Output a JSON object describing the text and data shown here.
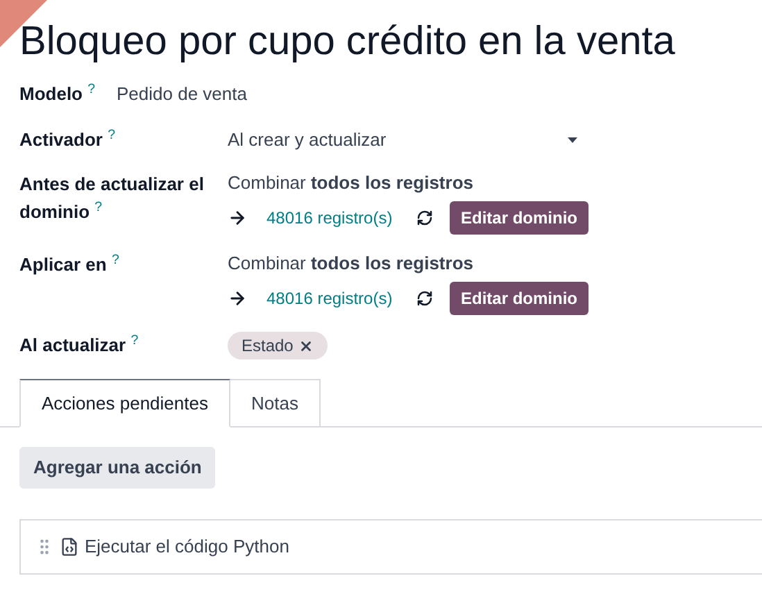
{
  "title": "Bloqueo por cupo crédito en la venta",
  "model": {
    "label": "Modelo $^{?}$",
    "value": "Pedido de venta"
  },
  "trigger": {
    "label": "Activador $^{?}$",
    "value": "Al crear y actualizar"
  },
  "domains": [
    {
      "label": "Antes de actualizar el dominio $^{?}$",
      "summary": "Combinar **todos los registros**",
      "count": "48016 registro(s)",
      "button": "Editar dominio"
    },
    {
      "label": "Aplicar en $^{?}$",
      "summary": "Combinar **todos los registros**",
      "count": "48016 registro(s)",
      "button": "Editar dominio"
    }
  ],
  "on_update": {
    "label": "Al actualizar $^{?}$",
    "tags": [
      "Estado"
    ]
  },
  "tabs": [
    {
      "label": "Acciones pendientes",
      "selected": true
    },
    {
      "label": "Notas",
      "selected": false
    }
  ],
  "add_button": "Agregar una acción",
  "actions": [
    {
      "label": "Ejecutar el código Python"
    }
  ]
}
